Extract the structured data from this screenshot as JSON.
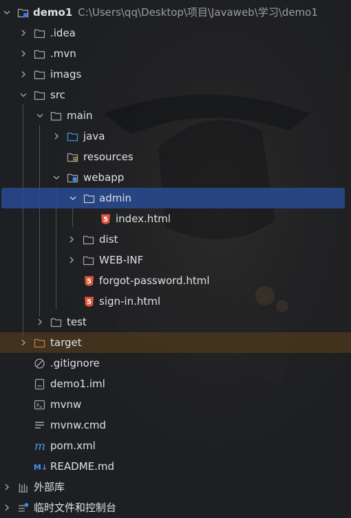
{
  "root": {
    "name": "demo1",
    "path": "C:\\Users\\qq\\Desktop\\项目\\Javaweb\\学习\\demo1"
  },
  "tree": {
    "idea": ".idea",
    "mvn": ".mvn",
    "imags": "imags",
    "src": "src",
    "main": "main",
    "java": "java",
    "resources": "resources",
    "webapp": "webapp",
    "admin": "admin",
    "index_html": "index.html",
    "dist": "dist",
    "web_inf": "WEB-INF",
    "forgot_password": "forgot-password.html",
    "sign_in": "sign-in.html",
    "test": "test",
    "target": "target",
    "gitignore": ".gitignore",
    "demo1_iml": "demo1.iml",
    "mvnw": "mvnw",
    "mvnw_cmd": "mvnw.cmd",
    "pom_xml": "pom.xml",
    "readme": "README.md",
    "external_libs": "外部库",
    "scratches": "临时文件和控制台"
  },
  "icons": {
    "md_badge": "M↓",
    "maven": "m",
    "html_badge": "5"
  },
  "colors": {
    "selected_row": "#2d4c8f",
    "excluded_row": "#4d3a1e",
    "folder": "#a4a8b0",
    "source_folder": "#3d8fe0",
    "excluded_folder": "#c97a4d",
    "html_icon": "#e2553b",
    "maven_icon": "#4a8fe7"
  }
}
